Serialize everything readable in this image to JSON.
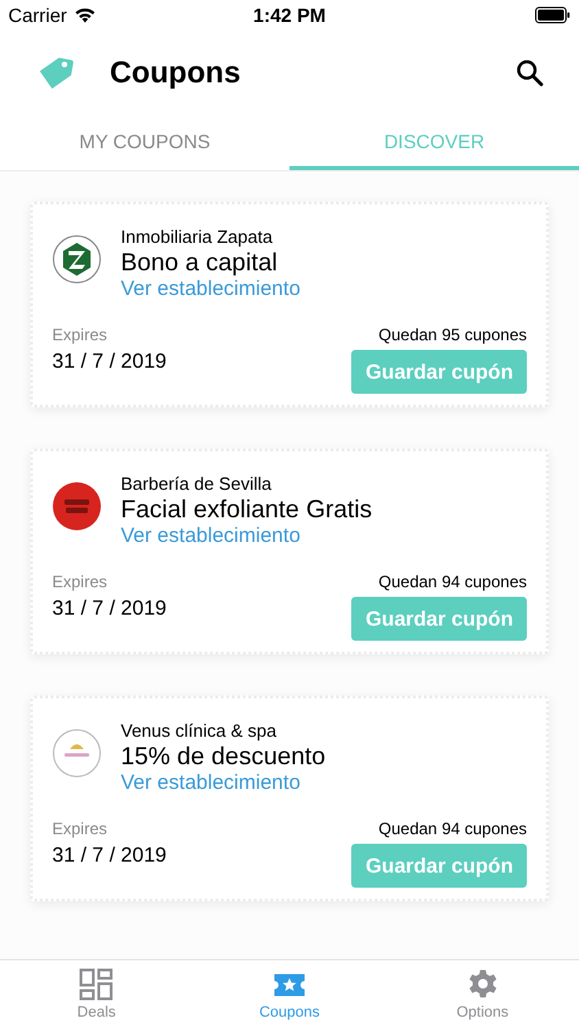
{
  "status_bar": {
    "carrier": "Carrier",
    "time": "1:42 PM"
  },
  "header": {
    "title": "Coupons"
  },
  "tabs": [
    {
      "label": "MY COUPONS",
      "selected": false
    },
    {
      "label": "DISCOVER",
      "selected": true
    }
  ],
  "coupons": [
    {
      "merchant": "Inmobiliaria Zapata",
      "title": "Bono a capital",
      "link": "Ver establecimiento",
      "expires_label": "Expires",
      "expires": "31 / 7 / 2019",
      "remaining": "Quedan 95 cupones",
      "button": "Guardar cupón"
    },
    {
      "merchant": "Barbería de Sevilla",
      "title": "Facial exfoliante Gratis",
      "link": "Ver establecimiento",
      "expires_label": "Expires",
      "expires": "31 / 7 / 2019",
      "remaining": "Quedan 94 cupones",
      "button": "Guardar cupón"
    },
    {
      "merchant": "Venus clínica & spa",
      "title": "15% de descuento",
      "link": "Ver establecimiento",
      "expires_label": "Expires",
      "expires": "31 / 7 / 2019",
      "remaining": "Quedan 94 cupones",
      "button": "Guardar cupón"
    }
  ],
  "tab_bar": [
    {
      "label": "Deals",
      "selected": false
    },
    {
      "label": "Coupons",
      "selected": true
    },
    {
      "label": "Options",
      "selected": false
    }
  ]
}
